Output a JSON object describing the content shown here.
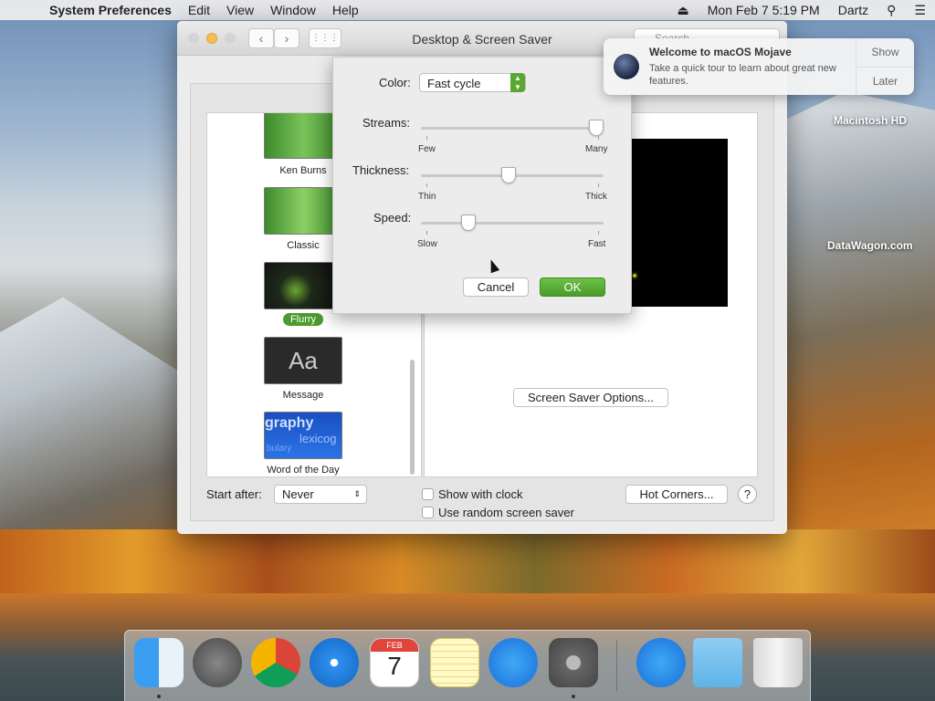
{
  "menubar": {
    "app": "System Preferences",
    "items": [
      "Edit",
      "View",
      "Window",
      "Help"
    ],
    "clock": "Mon Feb 7  5:19 PM",
    "user": "Dartz"
  },
  "window": {
    "title": "Desktop & Screen Saver",
    "search_placeholder": "Search"
  },
  "savers": [
    {
      "label": "Ken Burns"
    },
    {
      "label": "Classic"
    },
    {
      "label": "Flurry",
      "selected": true
    },
    {
      "label": "Message",
      "thumb_text": "Aa"
    },
    {
      "label": "Word of the Day",
      "thumb_text": "graphy",
      "thumb_text2": "lexicog",
      "thumb_text3": "bulary"
    }
  ],
  "preview": {
    "options_button": "Screen Saver Options..."
  },
  "bottom": {
    "start_after_label": "Start after:",
    "start_after_value": "Never",
    "show_clock": "Show with clock",
    "random": "Use random screen saver",
    "hot_corners": "Hot Corners...",
    "help": "?"
  },
  "sheet": {
    "color_label": "Color:",
    "color_value": "Fast cycle",
    "streams_label": "Streams:",
    "streams_min": "Few",
    "streams_max": "Many",
    "streams_level": 1.0,
    "thickness_label": "Thickness:",
    "thickness_min": "Thin",
    "thickness_max": "Thick",
    "thickness_level": 0.5,
    "speed_label": "Speed:",
    "speed_min": "Slow",
    "speed_max": "Fast",
    "speed_level": 0.27,
    "cancel": "Cancel",
    "ok": "OK"
  },
  "notification": {
    "title": "Welcome to macOS Mojave",
    "body": "Take a quick tour to learn about great new features.",
    "show": "Show",
    "later": "Later"
  },
  "desktop": {
    "disk": "Macintosh HD",
    "watermark": "DataWagon.com"
  },
  "dock": {
    "calendar_month": "FEB",
    "calendar_day": "7",
    "apps": [
      "finder-icon",
      "launchpad-icon",
      "chrome-icon",
      "safari-icon",
      "calendar-icon",
      "notes-icon",
      "app-store-icon",
      "system-preferences-icon",
      "app-store-icon",
      "downloads-folder-icon",
      "trash-icon"
    ]
  }
}
